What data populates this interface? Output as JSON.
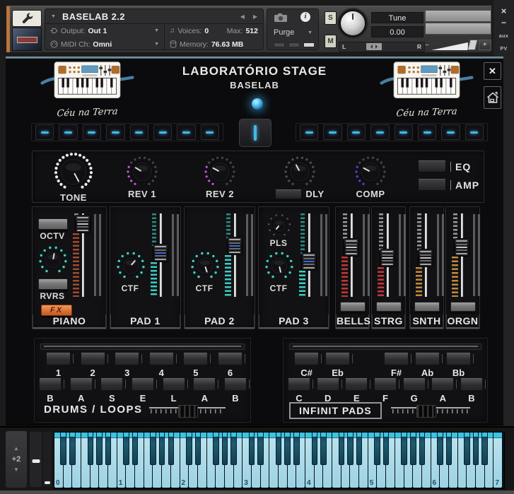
{
  "header": {
    "title": "BASELAB 2.2",
    "output_label": "Output:",
    "output_value": "Out 1",
    "midi_label": "MIDI Ch:",
    "midi_value": "Omni",
    "voices_label": "Voices:",
    "voices_value": "0",
    "max_label": "Max:",
    "max_value": "512",
    "memory_label": "Memory:",
    "memory_value": "76.63 MB",
    "purge": "Purge",
    "solo": "S",
    "mute": "M",
    "tune_label": "Tune",
    "tune_value": "0.00",
    "pan_left": "L",
    "pan_right": "R",
    "vol_minus": "−",
    "vol_plus": "+",
    "win": {
      "close": "×",
      "min": "−",
      "aux": "aux",
      "pv": "PV"
    },
    "carets": {
      "down": "▼",
      "up": "▲",
      "prev": "◀",
      "next": "▶"
    }
  },
  "instrument": {
    "title": "LABORATÓRIO STAGE",
    "subtitle": "BASELAB",
    "logo_caption": "Céu na Terra",
    "close": "✕",
    "accent": "#47b7e6",
    "preset_left_count": 8,
    "preset_right_count": 8,
    "knobs": [
      {
        "label": "TONE",
        "style": "ring-full",
        "color": "#ededed"
      },
      {
        "label": "REV 1",
        "style": "ring-lit",
        "color": "#c455d8"
      },
      {
        "label": "REV 2",
        "style": "ring-lit",
        "color": "#c455d8"
      },
      {
        "label": "DLY",
        "style": "ring-dim",
        "color": "",
        "button": true
      },
      {
        "label": "COMP",
        "style": "ring-lit",
        "color": "#4a4ada"
      }
    ],
    "eq": "EQ",
    "amp": "AMP",
    "channels": [
      {
        "name": "PIANO",
        "size": "large",
        "button_top": "OCTV",
        "button_mid": "RVRS",
        "fx": "FX",
        "knob": "",
        "led": "#a04a30",
        "led_top": "#8a8a8a",
        "handle": 2,
        "pointer": 10
      },
      {
        "name": "PAD 1",
        "size": "large",
        "knob": "CTF",
        "led": "#39cfc0",
        "led_top": "#2d8a80",
        "handle": 43,
        "pointer": 40,
        "accent": true
      },
      {
        "name": "PAD 2",
        "size": "large",
        "knob": "CTF",
        "led": "#39cfc0",
        "led_top": "#2d8a80",
        "handle": 33,
        "pointer": 163,
        "accent": true
      },
      {
        "name": "PAD 3",
        "size": "large",
        "knob_top": "PLS",
        "knob": "CTF",
        "led": "#39cfc0",
        "led_top": "#2d8a80",
        "handle": 55,
        "pointer": 168,
        "accent": true
      },
      {
        "name": "BELLS",
        "size": "small",
        "led": "#c23636",
        "led_top": "#9a9a9a",
        "handle": 35,
        "pointer": 0
      },
      {
        "name": "STRG",
        "size": "small",
        "led": "#c23636",
        "led_top": "#9a9a9a",
        "handle": 50,
        "pointer": 0
      },
      {
        "name": "SNTH",
        "size": "small",
        "led": "#c28a3a",
        "led_top": "#9a9a9a",
        "handle": 50,
        "pointer": 0
      },
      {
        "name": "ORGN",
        "size": "small",
        "led": "#c28a3a",
        "led_top": "#9a9a9a",
        "handle": 35,
        "pointer": 0
      }
    ],
    "drums": {
      "title": "DRUMS / LOOPS",
      "numbers": [
        "1",
        "2",
        "3",
        "4",
        "5",
        "6"
      ],
      "letters": [
        "B",
        "A",
        "S",
        "E",
        "L",
        "A",
        "B"
      ]
    },
    "pads": {
      "title": "INFINIT PADS",
      "black_keys": [
        "C#",
        "Eb",
        "F#",
        "Ab",
        "Bb"
      ],
      "white_keys": [
        "C",
        "D",
        "E",
        "F",
        "G",
        "A",
        "B"
      ]
    }
  },
  "keyboard": {
    "transpose": "+2",
    "octaves": [
      "0",
      "1",
      "2",
      "3",
      "4",
      "5",
      "6",
      "7"
    ]
  }
}
